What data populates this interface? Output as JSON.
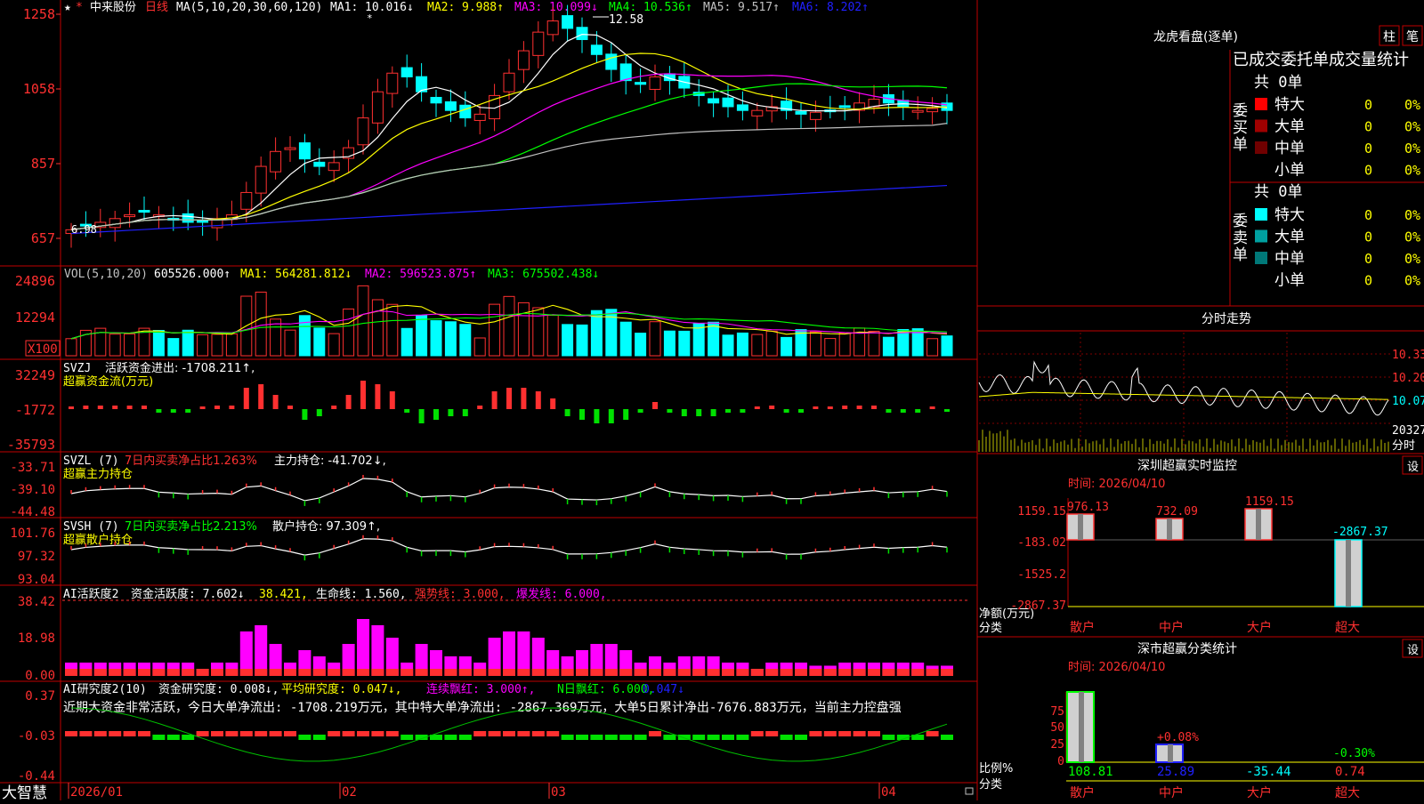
{
  "colors": {
    "up": "#ff3030",
    "down": "#00ffff",
    "ma1": "#ffffff",
    "ma2": "#ffff00",
    "ma3": "#ff00ff",
    "ma4": "#00ff00",
    "ma5": "#c0c0c0",
    "ma6": "#2020ff",
    "panel_border": "#c00000",
    "green": "#00e000",
    "magenta": "#ff00ff"
  },
  "main_chart": {
    "ticker_icon": "star-icon",
    "name": "中来股份",
    "period": "日线",
    "ma_label": "MA(5,10,20,30,60,120)",
    "ma": [
      {
        "label": "MA1:",
        "value": "10.016↓"
      },
      {
        "label": "MA2:",
        "value": "9.988↑"
      },
      {
        "label": "MA3:",
        "value": "10.099↓"
      },
      {
        "label": "MA4:",
        "value": "10.536↑"
      },
      {
        "label": "MA5:",
        "value": "9.517↑"
      },
      {
        "label": "MA6:",
        "value": "8.202↑"
      }
    ],
    "y_ticks": [
      "1258",
      "1058",
      "857",
      "657"
    ],
    "high_marker": "12.58",
    "low_marker": "6.98"
  },
  "vol": {
    "label": "VOL(5,10,20)",
    "value": "605526.000↑",
    "ma1": "MA1: 564281.812↓",
    "ma2": "MA2: 596523.875↑",
    "ma3": "MA3: 675502.438↓",
    "y_ticks": [
      "24896",
      "12294"
    ],
    "unit": "X100"
  },
  "svzj": {
    "title": "SVZJ",
    "desc": "活跃资金进出: -1708.211↑,",
    "subtitle": "超赢资金流(万元)",
    "y_ticks": [
      "32249",
      "-1772",
      "-35793"
    ]
  },
  "svzl": {
    "title": "SVZL (7)",
    "desc": "7日内买卖净占比1.263%",
    "hold": "主力持仓: -41.702↓,",
    "subtitle": "超赢主力持仓",
    "y_ticks": [
      "-33.71",
      "-39.10",
      "-44.48"
    ]
  },
  "svsh": {
    "title": "SVSH (7)",
    "desc": "7日内买卖净占比2.213%",
    "hold": "散户持仓: 97.309↑,",
    "subtitle": "超赢散户持仓",
    "y_ticks": [
      "101.76",
      "97.32",
      "93.04"
    ]
  },
  "ai1": {
    "title": "AI活跃度2",
    "a": "资金活跃度: 7.602↓",
    "b": "38.421,",
    "c": "生命线: 1.560,",
    "d": "强势线: 3.000,",
    "e": "爆发线: 6.000,",
    "y_ticks": [
      "38.42",
      "18.98",
      "0.00"
    ]
  },
  "ai2": {
    "title": "AI研究度2(10)",
    "a": "资金研究度: 0.008↓,",
    "b": "平均研究度: 0.047↓,",
    "c": "连续飘红: 3.000↑,",
    "d": "N日飘红: 6.000,",
    "e": "0.047↓",
    "note": "近期大资金非常活跃，今日大单净流出: -1708.219万元，其中特大单净流出: -2867.369万元，大单5日累计净出-7676.883万元，当前主力控盘强",
    "y_ticks": [
      "0.37",
      "-0.03",
      "-0.44"
    ]
  },
  "x_axis": {
    "labels": [
      "2026/01",
      "02",
      "03",
      "04"
    ],
    "logo": "大智慧"
  },
  "right": {
    "lhb_title": "龙虎看盘(逐单)",
    "btn_col": "柱",
    "btn_pen": "笔",
    "stats_title": "已成交委托单成交量统计",
    "buy": {
      "side": "委买单",
      "total": "共 0单",
      "rows": [
        {
          "label": "特大",
          "count": "0",
          "pct": "0%",
          "color": "#ff0000"
        },
        {
          "label": "大单",
          "count": "0",
          "pct": "0%",
          "color": "#a00000"
        },
        {
          "label": "中单",
          "count": "0",
          "pct": "0%",
          "color": "#700000"
        },
        {
          "label": "小单",
          "count": "0",
          "pct": "0%",
          "color": ""
        }
      ]
    },
    "sell": {
      "side": "委卖单",
      "total": "共 0单",
      "rows": [
        {
          "label": "特大",
          "count": "0",
          "pct": "0%",
          "color": "#00ffff"
        },
        {
          "label": "大单",
          "count": "0",
          "pct": "0%",
          "color": "#00a0a0"
        },
        {
          "label": "中单",
          "count": "0",
          "pct": "0%",
          "color": "#007878"
        },
        {
          "label": "小单",
          "count": "0",
          "pct": "0%",
          "color": ""
        }
      ]
    },
    "intraday": {
      "title": "分时走势",
      "y_ticks": [
        "10.33",
        "10.20",
        "10.07"
      ],
      "vol": "20327",
      "vol_label": "分时"
    },
    "sz_monitor": {
      "title": "深圳超赢实时监控",
      "time": "时间: 2026/04/10",
      "btn": "设",
      "y_ticks": [
        "1159.15",
        "-183.02",
        "-1525.2",
        "-2867.37"
      ],
      "bar_values": [
        "976.13",
        "732.09",
        "1159.15",
        "-2867.37"
      ],
      "ylabel": "净额(万元)",
      "xlabel": "分类",
      "cats": [
        "散户",
        "中户",
        "大户",
        "超大"
      ]
    },
    "sz_class": {
      "title": "深市超赢分类统计",
      "time": "时间: 2026/04/10",
      "btn": "设",
      "y_ticks": [
        "75",
        "50",
        "25",
        "0"
      ],
      "top_vals": [
        "+0.08%",
        "-0.30%"
      ],
      "bottom_vals": [
        "108.81",
        "25.89",
        "-35.44",
        "0.74"
      ],
      "ylabel": "比例%",
      "xlabel": "分类",
      "cats": [
        "散户",
        "中户",
        "大户",
        "超大"
      ]
    }
  }
}
